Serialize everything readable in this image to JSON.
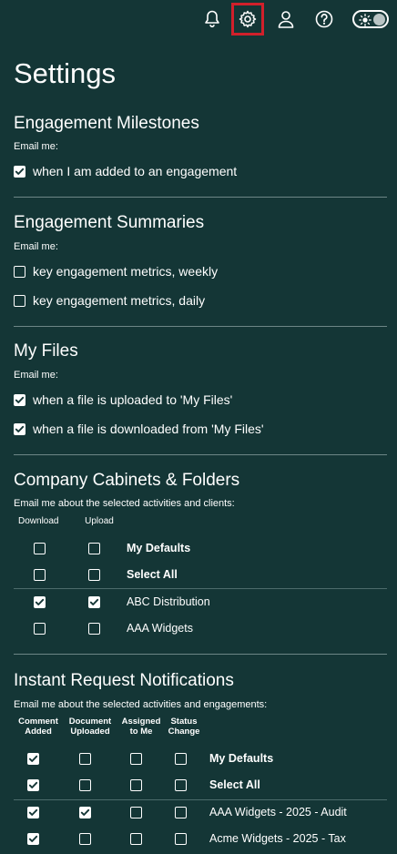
{
  "topbar": {
    "icons": [
      "bell-icon",
      "gear-icon",
      "user-icon",
      "help-icon",
      "theme-toggle"
    ]
  },
  "page": {
    "title": "Settings"
  },
  "engagement_milestones": {
    "title": "Engagement Milestones",
    "caption": "Email me:",
    "options": [
      {
        "label": "when I am added to an engagement",
        "checked": true
      }
    ]
  },
  "engagement_summaries": {
    "title": "Engagement Summaries",
    "caption": "Email me:",
    "options": [
      {
        "label": "key engagement metrics, weekly",
        "checked": false
      },
      {
        "label": "key engagement metrics, daily",
        "checked": false
      }
    ]
  },
  "my_files": {
    "title": "My Files",
    "caption": "Email me:",
    "options": [
      {
        "label": "when a file is uploaded to 'My Files'",
        "checked": true
      },
      {
        "label": "when a file is downloaded from 'My Files'",
        "checked": true
      }
    ]
  },
  "company_cabinets": {
    "title": "Company Cabinets & Folders",
    "caption": "Email me about the selected activities and clients:",
    "columns": [
      "Download",
      "Upload"
    ],
    "rows": [
      {
        "label": "My Defaults",
        "bold": true,
        "values": [
          false,
          false
        ]
      },
      {
        "label": "Select All",
        "bold": true,
        "values": [
          false,
          false
        ]
      },
      {
        "label": "ABC Distribution",
        "bold": false,
        "values": [
          true,
          true
        ]
      },
      {
        "label": "AAA Widgets",
        "bold": false,
        "values": [
          false,
          false
        ]
      }
    ]
  },
  "instant_requests": {
    "title": "Instant Request Notifications",
    "caption": "Email me about the selected activities and engagements:",
    "columns": [
      [
        "Comment",
        "Added"
      ],
      [
        "Document",
        "Uploaded"
      ],
      [
        "Assigned",
        "to Me"
      ],
      [
        "Status",
        "Change"
      ]
    ],
    "rows": [
      {
        "label": "My Defaults",
        "bold": true,
        "values": [
          true,
          false,
          false,
          false
        ]
      },
      {
        "label": "Select All",
        "bold": true,
        "values": [
          true,
          false,
          false,
          false
        ]
      },
      {
        "label": "AAA Widgets - 2025 - Audit",
        "bold": false,
        "values": [
          true,
          true,
          false,
          false
        ]
      },
      {
        "label": "Acme Widgets - 2025 - Tax",
        "bold": false,
        "values": [
          true,
          false,
          false,
          false
        ]
      }
    ]
  }
}
